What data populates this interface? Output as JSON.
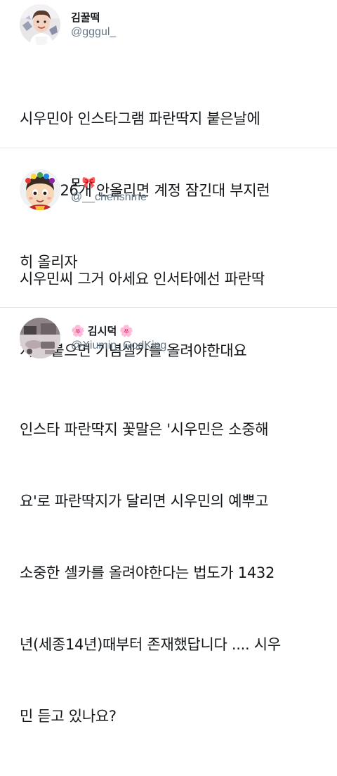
{
  "tweets": [
    {
      "display_name": "김꿀떡",
      "handle": "@gggul_",
      "avatar_icon": "user-avatar-photo",
      "body_lines": [
        "시우민아 인스타그램 파란딱지 붙은날에",
        "셀카 326개 안올리면 계정 잠긴대 부지런",
        "히 올리자"
      ]
    },
    {
      "display_name": "모",
      "name_emoji_after": "🎀",
      "handle": "@__cherishme",
      "avatar_icon": "cartoon-avatar",
      "body_lines": [
        "시우민씨 그거 아세요 인서타에선 파란딱",
        "지가 붙으면 기념셀카를 올려야한대요"
      ]
    },
    {
      "display_name": "김시덕",
      "name_emoji_before": "🌸",
      "name_emoji_after": "🌸",
      "handle": "@Xiumin_GodKing",
      "avatar_icon": "desk-photo-avatar",
      "body_lines": [
        "인스타 파란딱지 꽃말은 '시우민은 소중해",
        "요'로 파란딱지가 달리면 시우민의 예뿌고",
        "소중한 셀카를 올려야한다는 법도가 1432",
        "년(세종14년)때부터 존재했답니다 .... 시우",
        "민 듣고 있나요?"
      ]
    }
  ],
  "colors": {
    "text": "#14171a",
    "handle": "#657786",
    "divider": "#e3e6e8"
  }
}
